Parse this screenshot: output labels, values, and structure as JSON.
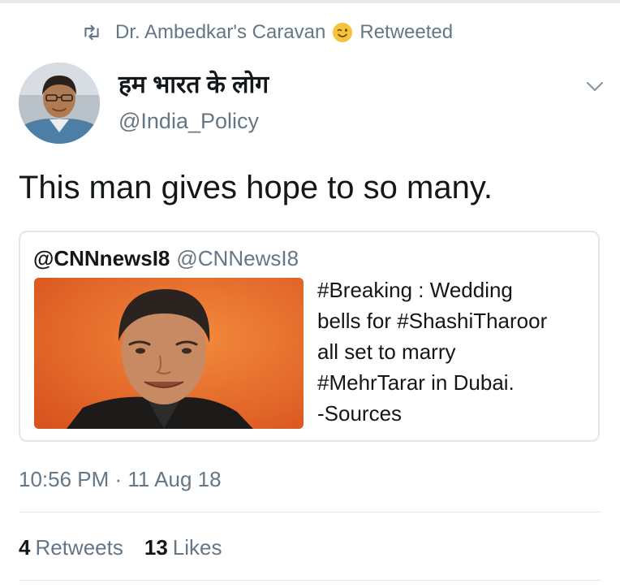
{
  "retweet_context": {
    "icon": "retweet-icon",
    "name": "Dr. Ambedkar's Caravan",
    "emoji": "winking-face-emoji",
    "label": "Retweeted"
  },
  "tweet": {
    "author_name": "हम भारत के लोग",
    "author_handle": "@India_Policy",
    "text": "This man gives hope to so many.",
    "timestamp": "10:56 PM · 11 Aug 18",
    "retweets_count": "4",
    "retweets_label": "Retweets",
    "likes_count": "13",
    "likes_label": "Likes"
  },
  "quoted_tweet": {
    "author_name": "@CNNnewsI8",
    "author_handle": "@CNNewsI8",
    "text_lines": [
      "#Breaking : Wedding",
      "bells for #ShashiTharoor",
      "all set to marry",
      "#MehrTarar in Dubai.",
      "-Sources"
    ]
  },
  "colors": {
    "primary_text": "#14171a",
    "secondary_text": "#657786",
    "border": "#e1e8ed",
    "image_background": "#e8622a"
  }
}
